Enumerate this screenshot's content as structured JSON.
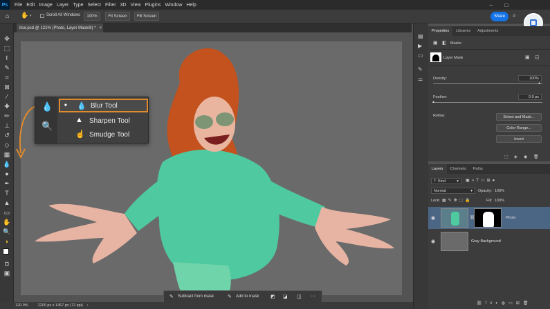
{
  "app": {
    "logo": "Ps"
  },
  "menu": [
    "File",
    "Edit",
    "Image",
    "Layer",
    "Type",
    "Select",
    "Filter",
    "3D",
    "View",
    "Plugins",
    "Window",
    "Help"
  ],
  "options": {
    "scroll_all": "Scroll All Windows",
    "zoom_100": "100%",
    "fit_screen": "Fit Screen",
    "fill_screen": "Fill Screen",
    "share": "Share"
  },
  "document": {
    "tab_title": "blur.psd @ 121% (Photo, Layer Mask/8) *",
    "close": "×"
  },
  "flyout": {
    "items": [
      {
        "label": "Blur Tool",
        "icon": "drop-icon"
      },
      {
        "label": "Sharpen Tool",
        "icon": "triangle-icon"
      },
      {
        "label": "Smudge Tool",
        "icon": "finger-icon"
      }
    ]
  },
  "contextbar": {
    "subtract": "Subtract from mask",
    "add": "Add to mask",
    "more": "···"
  },
  "status": {
    "zoom": "120.9%",
    "size": "2200 px x 1467 px (72 ppi)"
  },
  "properties": {
    "tabs": [
      "Properties",
      "Libraries",
      "Adjustments"
    ],
    "masks_label": "Masks",
    "layer_mask_label": "Layer Mask",
    "density_label": "Density:",
    "density_value": "100%",
    "feather_label": "Feather:",
    "feather_value": "0.0 px",
    "refine_label": "Refine:",
    "select_mask": "Select and Mask...",
    "color_range": "Color Range...",
    "invert": "Invert"
  },
  "layers_panel": {
    "tabs": [
      "Layers",
      "Channels",
      "Paths"
    ],
    "filter_kind": "Kind",
    "blend_mode": "Normal",
    "opacity_label": "Opacity:",
    "opacity_value": "100%",
    "lock_label": "Lock:",
    "fill_label": "Fill:",
    "fill_value": "100%",
    "layers": [
      {
        "name": "Photo"
      },
      {
        "name": "Gray Background"
      }
    ]
  },
  "colors": {
    "accent_orange": "#e08a2c",
    "share_blue": "#1473e6",
    "hoodie": "#4fc9a0",
    "hair": "#c4521e"
  }
}
